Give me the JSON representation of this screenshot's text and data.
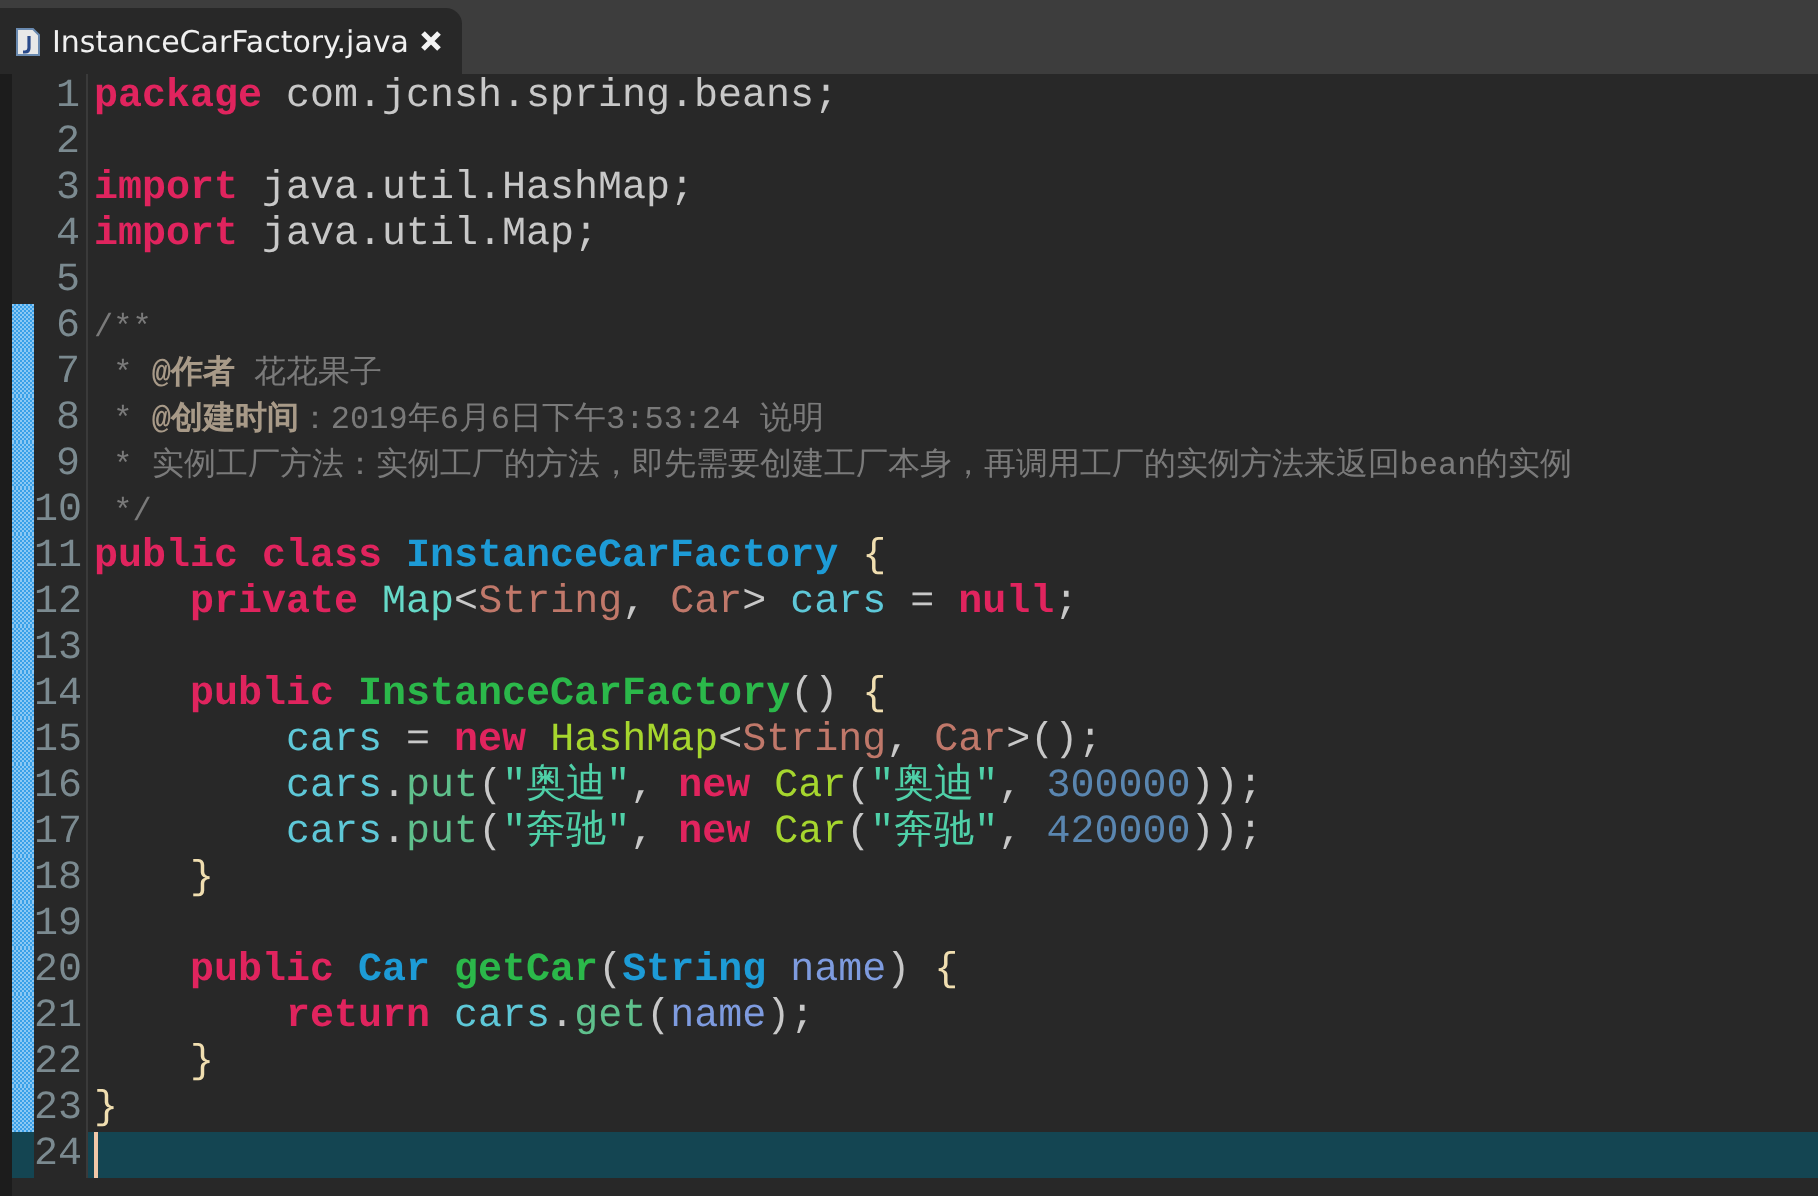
{
  "tab": {
    "title": "InstanceCarFactory.java",
    "selected": true
  },
  "lines": [
    {
      "number": "1",
      "changed": false,
      "current": false,
      "tokens": [
        {
          "kind": "keyword",
          "text": "package"
        },
        {
          "kind": "plain",
          "text": " com.jcnsh.spring.beans;"
        }
      ]
    },
    {
      "number": "2",
      "changed": false,
      "current": false
    },
    {
      "number": "3",
      "changed": false,
      "current": false,
      "tokens": [
        {
          "kind": "keyword",
          "text": "import"
        },
        {
          "kind": "plain",
          "text": " java.util.HashMap;"
        }
      ]
    },
    {
      "number": "4",
      "changed": false,
      "current": false,
      "tokens": [
        {
          "kind": "keyword",
          "text": "import"
        },
        {
          "kind": "plain",
          "text": " java.util.Map;"
        }
      ]
    },
    {
      "number": "5",
      "changed": false,
      "current": false
    },
    {
      "number": "6",
      "changed": true,
      "current": false,
      "tokens": [
        {
          "kind": "comment",
          "text": "/**"
        }
      ]
    },
    {
      "number": "7",
      "changed": true,
      "current": false,
      "tokens": [
        {
          "kind": "comment",
          "text": " * "
        },
        {
          "kind": "doctag",
          "text": "@作者"
        },
        {
          "kind": "comment",
          "text": " 花花果子"
        }
      ]
    },
    {
      "number": "8",
      "changed": true,
      "current": false,
      "tokens": [
        {
          "kind": "comment",
          "text": " * "
        },
        {
          "kind": "doctag",
          "text": "@创建时间"
        },
        {
          "kind": "comment",
          "text": "：2019年6月6日下午3:53:24 说明"
        }
      ]
    },
    {
      "number": "9",
      "changed": true,
      "current": false,
      "tokens": [
        {
          "kind": "comment",
          "text": " * 实例工厂方法：实例工厂的方法，即先需要创建工厂本身，再调用工厂的实例方法来返回bean的实例"
        }
      ]
    },
    {
      "number": "10",
      "changed": true,
      "current": false,
      "tokens": [
        {
          "kind": "comment",
          "text": " */"
        }
      ]
    },
    {
      "number": "11",
      "changed": true,
      "current": false,
      "tokens": [
        {
          "kind": "keyword",
          "text": "public class "
        },
        {
          "kind": "classname",
          "text": "InstanceCarFactory "
        },
        {
          "kind": "brace",
          "text": "{"
        }
      ]
    },
    {
      "number": "12",
      "changed": true,
      "current": false,
      "tokens": [
        {
          "kind": "keyword",
          "text": "    private "
        },
        {
          "kind": "type",
          "text": "Map"
        },
        {
          "kind": "plain",
          "text": "<"
        },
        {
          "kind": "typearg",
          "text": "String"
        },
        {
          "kind": "plain",
          "text": ", "
        },
        {
          "kind": "typearg",
          "text": "Car"
        },
        {
          "kind": "plain",
          "text": "> "
        },
        {
          "kind": "field",
          "text": "cars"
        },
        {
          "kind": "plain",
          "text": " = "
        },
        {
          "kind": "keyword",
          "text": "null"
        },
        {
          "kind": "plain",
          "text": ";"
        }
      ]
    },
    {
      "number": "13",
      "changed": true,
      "current": false
    },
    {
      "number": "14",
      "changed": true,
      "current": false,
      "tokens": [
        {
          "kind": "keyword",
          "text": "    public "
        },
        {
          "kind": "methoddecl",
          "text": "InstanceCarFactory"
        },
        {
          "kind": "plain",
          "text": "() "
        },
        {
          "kind": "brace",
          "text": "{"
        }
      ]
    },
    {
      "number": "15",
      "changed": true,
      "current": false,
      "tokens": [
        {
          "kind": "field",
          "text": "        cars"
        },
        {
          "kind": "plain",
          "text": " = "
        },
        {
          "kind": "keyword",
          "text": "new "
        },
        {
          "kind": "ctor",
          "text": "HashMap"
        },
        {
          "kind": "plain",
          "text": "<"
        },
        {
          "kind": "typearg",
          "text": "String"
        },
        {
          "kind": "plain",
          "text": ", "
        },
        {
          "kind": "typearg",
          "text": "Car"
        },
        {
          "kind": "plain",
          "text": ">();"
        }
      ]
    },
    {
      "number": "16",
      "changed": true,
      "current": false,
      "tokens": [
        {
          "kind": "field",
          "text": "        cars"
        },
        {
          "kind": "plain",
          "text": "."
        },
        {
          "kind": "call",
          "text": "put"
        },
        {
          "kind": "plain",
          "text": "("
        },
        {
          "kind": "string",
          "text": "\"奥迪\""
        },
        {
          "kind": "plain",
          "text": ", "
        },
        {
          "kind": "keyword",
          "text": "new "
        },
        {
          "kind": "ctor",
          "text": "Car"
        },
        {
          "kind": "plain",
          "text": "("
        },
        {
          "kind": "string",
          "text": "\"奥迪\""
        },
        {
          "kind": "plain",
          "text": ", "
        },
        {
          "kind": "number",
          "text": "300000"
        },
        {
          "kind": "plain",
          "text": "));"
        }
      ]
    },
    {
      "number": "17",
      "changed": true,
      "current": false,
      "tokens": [
        {
          "kind": "field",
          "text": "        cars"
        },
        {
          "kind": "plain",
          "text": "."
        },
        {
          "kind": "call",
          "text": "put"
        },
        {
          "kind": "plain",
          "text": "("
        },
        {
          "kind": "string",
          "text": "\"奔驰\""
        },
        {
          "kind": "plain",
          "text": ", "
        },
        {
          "kind": "keyword",
          "text": "new "
        },
        {
          "kind": "ctor",
          "text": "Car"
        },
        {
          "kind": "plain",
          "text": "("
        },
        {
          "kind": "string",
          "text": "\"奔驰\""
        },
        {
          "kind": "plain",
          "text": ", "
        },
        {
          "kind": "number",
          "text": "420000"
        },
        {
          "kind": "plain",
          "text": "));"
        }
      ]
    },
    {
      "number": "18",
      "changed": true,
      "current": false,
      "tokens": [
        {
          "kind": "brace",
          "text": "    }"
        }
      ]
    },
    {
      "number": "19",
      "changed": true,
      "current": false
    },
    {
      "number": "20",
      "changed": true,
      "current": false,
      "tokens": [
        {
          "kind": "keyword",
          "text": "    public "
        },
        {
          "kind": "classname",
          "text": "Car "
        },
        {
          "kind": "methoddecl",
          "text": "getCar"
        },
        {
          "kind": "plain",
          "text": "("
        },
        {
          "kind": "classname",
          "text": "String "
        },
        {
          "kind": "param",
          "text": "name"
        },
        {
          "kind": "plain",
          "text": ") "
        },
        {
          "kind": "brace",
          "text": "{"
        }
      ]
    },
    {
      "number": "21",
      "changed": true,
      "current": false,
      "tokens": [
        {
          "kind": "keyword",
          "text": "        return "
        },
        {
          "kind": "field",
          "text": "cars"
        },
        {
          "kind": "plain",
          "text": "."
        },
        {
          "kind": "call",
          "text": "get"
        },
        {
          "kind": "plain",
          "text": "("
        },
        {
          "kind": "param",
          "text": "name"
        },
        {
          "kind": "plain",
          "text": ");"
        }
      ]
    },
    {
      "number": "22",
      "changed": true,
      "current": false,
      "tokens": [
        {
          "kind": "brace",
          "text": "    }"
        }
      ]
    },
    {
      "number": "23",
      "changed": true,
      "current": false,
      "tokens": [
        {
          "kind": "brace",
          "text": "}"
        }
      ]
    },
    {
      "number": "24",
      "changed": false,
      "current": true
    }
  ]
}
